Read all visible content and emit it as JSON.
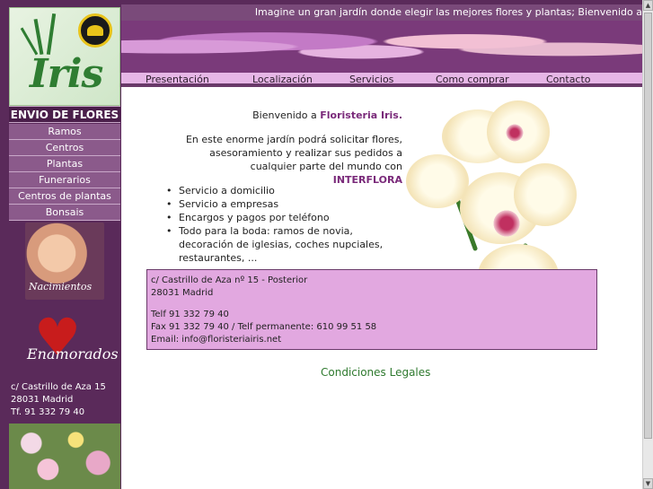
{
  "marquee": {
    "text": "Imagine un gran jardín donde elegir las mejores flores y plantas; Bienvenido a"
  },
  "logo": {
    "text": "Iris"
  },
  "nav": {
    "tabs": [
      "Presentación",
      "Localización",
      "Servicios",
      "Como comprar",
      "Contacto"
    ]
  },
  "sidebar": {
    "title": "ENVIO DE FLORES",
    "items": [
      "Ramos",
      "Centros",
      "Plantas",
      "Funerarios",
      "Centros de plantas",
      "Bonsais"
    ],
    "promo_baby": "Nacimientos",
    "promo_heart": "Enamorados",
    "address": [
      "c/ Castrillo de Aza 15",
      "28031 Madrid",
      "Tf. 91 332 79 40"
    ]
  },
  "main": {
    "welcome_prefix": "Bienvenido a ",
    "welcome_name": "Floristeria Iris.",
    "intro_text": "En este enorme jardín podrá solicitar flores, asesoramiento y realizar sus pedidos a cualquier parte del mundo con ",
    "intro_brand": "INTERFLORA",
    "services": [
      "Servicio a domicilio",
      "Servicio a empresas",
      "Encargos y pagos por teléfono",
      "Todo para la boda: ramos de novia, decoración de iglesias, coches nupciales, restaurantes, ..."
    ],
    "contact": {
      "address1": "c/ Castrillo de Aza nº 15 - Posterior",
      "address2": "28031 Madrid",
      "telf": "Telf 91 332 79 40",
      "fax": "Fax 91 332 79 40 / Telf permanente: 610 99 51 58",
      "email": "Email: info@floristeriairis.net"
    },
    "legal": "Condiciones Legales"
  },
  "colors": {
    "brand_purple": "#5a2a5a",
    "menu_item": "#8b5a8b",
    "contact_bg": "#e2a8e0",
    "legal_green": "#2f7a2f"
  },
  "icons": {
    "scroll_up": "chevron-up-icon",
    "scroll_down": "chevron-down-icon"
  }
}
